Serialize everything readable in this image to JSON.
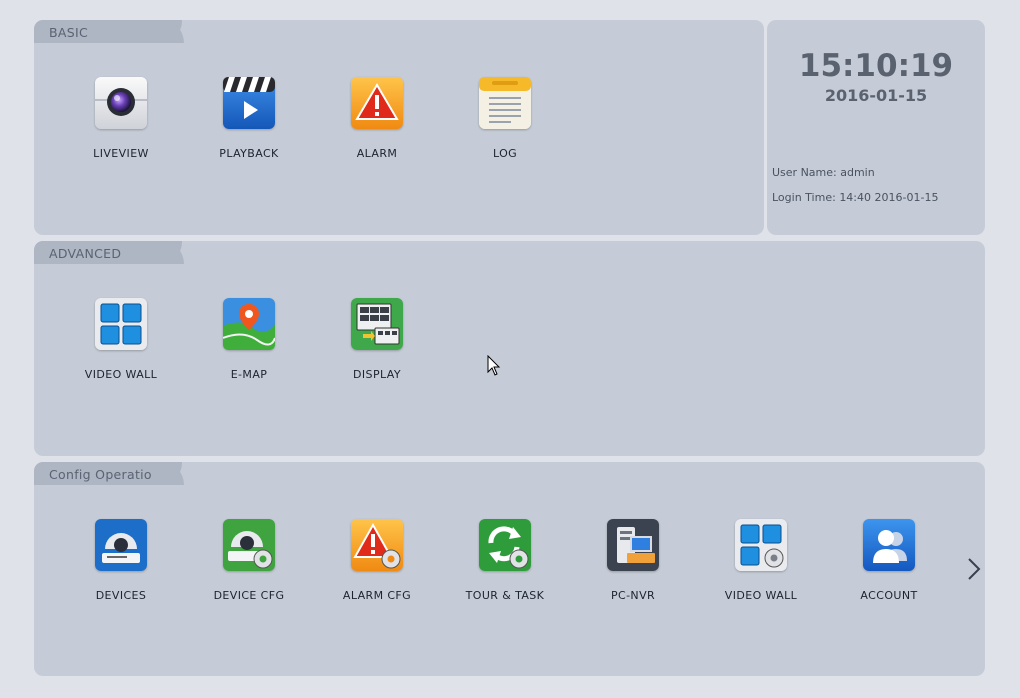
{
  "sections": {
    "basic": {
      "title": "BASIC",
      "tiles": [
        {
          "label": "LIVEVIEW",
          "icon": "camera-icon"
        },
        {
          "label": "PLAYBACK",
          "icon": "playback-icon"
        },
        {
          "label": "ALARM",
          "icon": "alarm-icon"
        },
        {
          "label": "LOG",
          "icon": "log-icon"
        }
      ]
    },
    "advanced": {
      "title": "ADVANCED",
      "tiles": [
        {
          "label": "VIDEO WALL",
          "icon": "video-wall-icon"
        },
        {
          "label": "E-MAP",
          "icon": "emap-icon"
        },
        {
          "label": "DISPLAY",
          "icon": "display-icon"
        }
      ]
    },
    "config": {
      "title": "Config Operation",
      "tiles": [
        {
          "label": "DEVICES",
          "icon": "devices-icon"
        },
        {
          "label": "DEVICE CFG",
          "icon": "device-cfg-icon"
        },
        {
          "label": "ALARM CFG",
          "icon": "alarm-cfg-icon"
        },
        {
          "label": "TOUR & TASK",
          "icon": "tour-task-icon"
        },
        {
          "label": "PC-NVR",
          "icon": "pc-nvr-icon"
        },
        {
          "label": "VIDEO WALL",
          "icon": "video-wall-cfg-icon"
        },
        {
          "label": "ACCOUNT",
          "icon": "account-icon"
        }
      ]
    }
  },
  "info": {
    "time": "15:10:19",
    "date": "2016-01-15",
    "user_name_label": "User Name:",
    "user_name": "admin",
    "login_time_label": "Login Time:",
    "login_time": "14:40 2016-01-15"
  },
  "colors": {
    "panel": "#c6ccd7",
    "tab": "#aeb5c3",
    "background": "#dfe2e8",
    "text": "#1c2430"
  }
}
